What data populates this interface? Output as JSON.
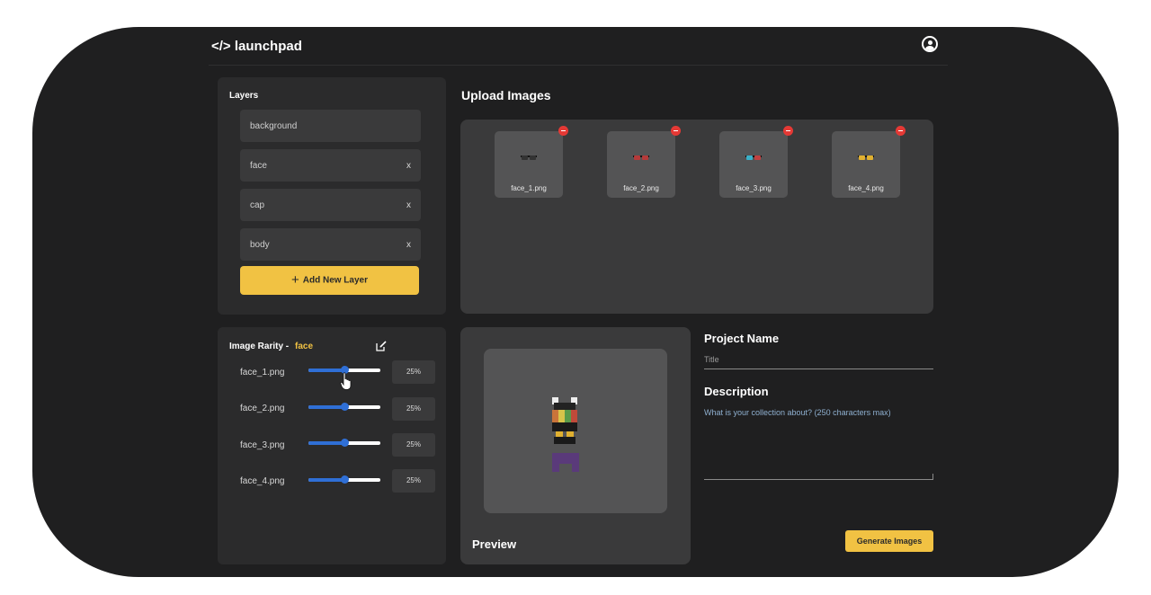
{
  "app": {
    "logo": "</> launchpad"
  },
  "layers": {
    "title": "Layers",
    "items": [
      {
        "label": "background",
        "remove": ""
      },
      {
        "label": "face",
        "remove": "x"
      },
      {
        "label": "cap",
        "remove": "x"
      },
      {
        "label": "body",
        "remove": "x"
      }
    ],
    "add_button": "Add New Layer"
  },
  "upload": {
    "title": "Upload Images",
    "files": [
      {
        "name": "face_1.png",
        "lens_color": "#333333"
      },
      {
        "name": "face_2.png",
        "lens_color": "#b53a3a"
      },
      {
        "name": "face_3.png",
        "lens_color": "#3ab0c8"
      },
      {
        "name": "face_4.png",
        "lens_color": "#e0b030"
      }
    ]
  },
  "rarity": {
    "title": "Image Rarity -",
    "layer": "face",
    "rows": [
      {
        "name": "face_1.png",
        "value": 0.5,
        "percent": "25%"
      },
      {
        "name": "face_2.png",
        "value": 0.5,
        "percent": "25%"
      },
      {
        "name": "face_3.png",
        "value": 0.5,
        "percent": "25%"
      },
      {
        "name": "face_4.png",
        "value": 0.5,
        "percent": "25%"
      }
    ]
  },
  "preview": {
    "label": "Preview"
  },
  "form": {
    "project_name_label": "Project Name",
    "project_name_placeholder": "Title",
    "description_label": "Description",
    "description_placeholder": "What is your collection about? (250 characters max)",
    "generate_button": "Generate Images"
  },
  "colors": {
    "accent": "#f1c243",
    "slider": "#2f6fd6",
    "delete": "#e53935"
  }
}
